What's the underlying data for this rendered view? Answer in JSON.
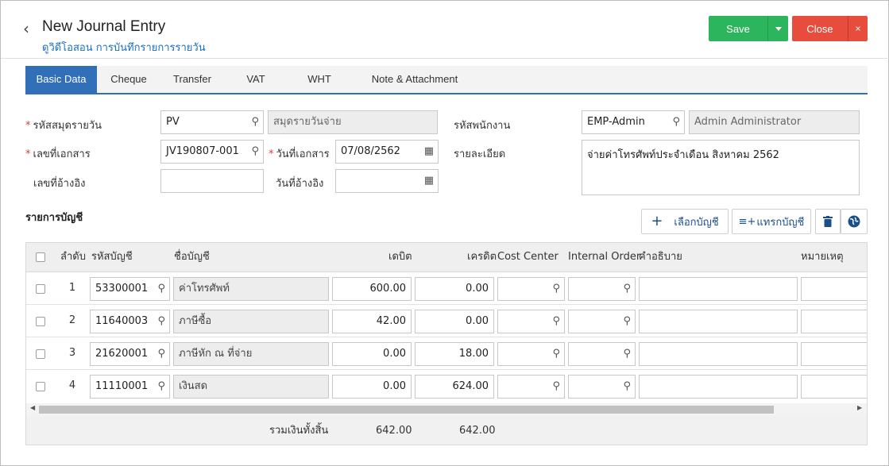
{
  "header": {
    "title": "New Journal Entry",
    "subtitle": "ดูวิดีโอสอน การบันทึกรายการรายวัน",
    "save_label": "Save",
    "close_label": "Close",
    "close_x": "×"
  },
  "tabs": [
    {
      "label": "Basic Data",
      "active": true
    },
    {
      "label": "Cheque",
      "active": false
    },
    {
      "label": "Transfer",
      "active": false
    },
    {
      "label": "VAT",
      "active": false
    },
    {
      "label": "WHT",
      "active": false
    },
    {
      "label": "Note & Attachment",
      "active": false
    }
  ],
  "form": {
    "journal_code_label": "รหัสสมุดรายวัน",
    "journal_code": "PV",
    "journal_name": "สมุดรายวันจ่าย",
    "employee_label": "รหัสพนักงาน",
    "employee_code": "EMP-Admin",
    "employee_name": "Admin Administrator",
    "doc_no_label": "เลขที่เอกสาร",
    "doc_no": "JV190807-001",
    "doc_date_label": "วันที่เอกสาร",
    "doc_date": "07/08/2562",
    "detail_label": "รายละเอียด",
    "detail": "จ่ายค่าโทรศัพท์ประจำเดือน สิงหาคม 2562",
    "ref_no_label": "เลขที่อ้างอิง",
    "ref_no": "",
    "ref_date_label": "วันที่อ้างอิง",
    "ref_date": ""
  },
  "accounts": {
    "section_title": "รายการบัญชี",
    "select_account_label": "เลือกบัญชี",
    "insert_account_label": "แทรกบัญชี",
    "columns": {
      "no": "ลำดับ",
      "account_code": "รหัสบัญชี",
      "account_name": "ชื่อบัญชี",
      "debit": "เดบิต",
      "credit": "เครดิต",
      "cost_center": "Cost Center",
      "internal_order": "Internal Order",
      "description": "คำอธิบาย",
      "remark": "หมายเหตุ"
    },
    "rows": [
      {
        "no": "1",
        "code": "53300001",
        "name": "ค่าโทรศัพท์",
        "debit": "600.00",
        "credit": "0.00"
      },
      {
        "no": "2",
        "code": "11640003",
        "name": "ภาษีซื้อ",
        "debit": "42.00",
        "credit": "0.00"
      },
      {
        "no": "3",
        "code": "21620001",
        "name": "ภาษีหัก ณ ที่จ่าย",
        "debit": "0.00",
        "credit": "18.00"
      },
      {
        "no": "4",
        "code": "11110001",
        "name": "เงินสด",
        "debit": "0.00",
        "credit": "624.00"
      }
    ],
    "total_label": "รวมเงินทั้งสิ้น",
    "total_debit": "642.00",
    "total_credit": "642.00"
  },
  "colors": {
    "save": "#2db55d",
    "close": "#e74c3c",
    "tab_active": "#3170b9",
    "link": "#1a6fc4"
  }
}
